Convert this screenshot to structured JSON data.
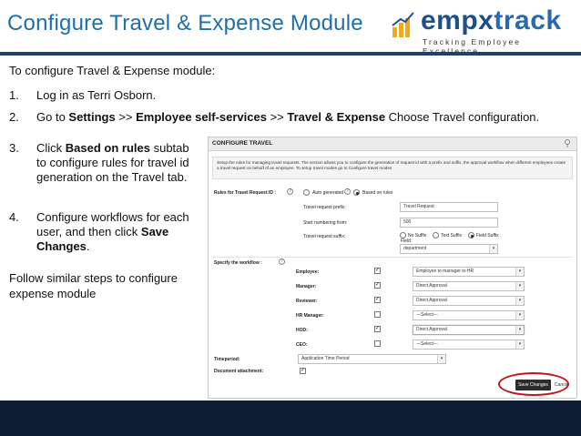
{
  "slide": {
    "title": "Configure Travel & Expense Module",
    "logo": {
      "word_part1": "empx",
      "word_part2": "track",
      "tagline": "Tracking Employee Excellence"
    },
    "intro": "To configure Travel & Expense module:",
    "step1": {
      "num": "1.",
      "text": "Log in as Terri Osborn."
    },
    "step2": {
      "num": "2.",
      "prefix": "Go to ",
      "settings": "Settings",
      "sep1": " >> ",
      "ess": "Employee self-services",
      "sep2": " >> ",
      "travel": "Travel & Expense",
      "suffix": "  Choose Travel configuration."
    },
    "step3": {
      "num": "3.",
      "prefix": "Click ",
      "bold": "Based on rules",
      "suffix": " subtab to configure rules for travel id generation  on the Travel tab."
    },
    "step4": {
      "num": "4.",
      "prefix": "Configure workflows for each user, and then click ",
      "bold": "Save Changes",
      "suffix": "."
    },
    "follow": "Follow similar steps to configure expense module"
  },
  "screenshot": {
    "header_title": "CONFIGURE TRAVEL",
    "description": "Setup the rules for managing travel requests. The section allows you to configure the generation of request id with a prefix and suffix, the approval workflow when different employees create a travel request on behalf of an employee. To setup travel modes go to Configure travel modes",
    "rules_label": "Rules for Travel Request ID :",
    "radio_auto": "Auto generated",
    "radio_rules": "Based on rules",
    "prefix_label": "Travel request prefix:",
    "prefix_value": "Travel Request",
    "start_label": "Start numbering from:",
    "start_value": "500",
    "suffix_label": "Travel request suffix:",
    "suffix_opt1": "No Suffix",
    "suffix_opt2": "Text Suffix",
    "suffix_opt3": "Field Suffix",
    "field_label": "Field:",
    "field_value": "department",
    "workflow_label": "Specify the workflow :",
    "rows": [
      {
        "label": "Employee:",
        "value": "Employee to manager to HR"
      },
      {
        "label": "Manager:",
        "value": "Direct Approval"
      },
      {
        "label": "Reviewer:",
        "value": "Direct Approval"
      },
      {
        "label": "HR Manager:",
        "value": "---Select---"
      },
      {
        "label": "HOD:",
        "value": "Direct Approval"
      },
      {
        "label": "CEO:",
        "value": "---Select---"
      }
    ],
    "timeperiod_label": "Timeperiod:",
    "timeperiod_value": "Application Time Period",
    "attachment_label": "Document attachment:",
    "save_label": "Save Changes",
    "cancel_label": "Cancel"
  }
}
